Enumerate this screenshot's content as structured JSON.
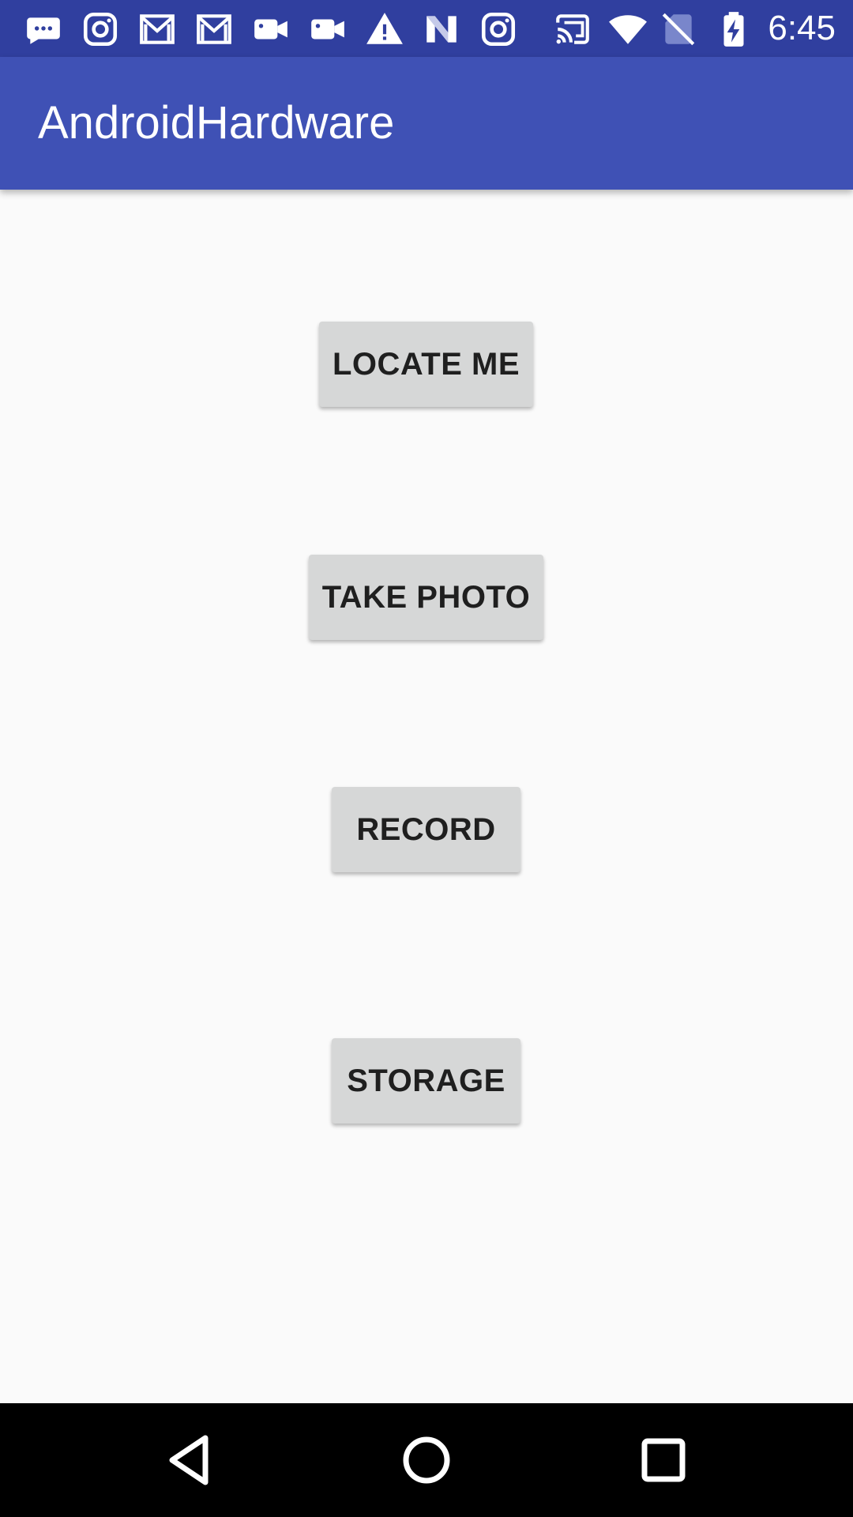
{
  "status_bar": {
    "time": "6:45",
    "background": "#303f9f",
    "notification_icons": [
      "messaging-icon",
      "instagram-icon",
      "gmail-icon",
      "gmail-icon",
      "video-camera-icon",
      "video-camera-icon",
      "warning-icon",
      "n-icon",
      "instagram-icon"
    ],
    "system_icons": [
      "cast-icon",
      "wifi-icon",
      "no-sim-icon",
      "battery-charging-icon"
    ]
  },
  "app_bar": {
    "title": "AndroidHardware",
    "background": "#3f51b5"
  },
  "buttons": {
    "locate_me": "LOCATE ME",
    "take_photo": "TAKE PHOTO",
    "record": "RECORD",
    "storage": "STORAGE"
  },
  "nav_bar": {
    "items": [
      "back-icon",
      "home-icon",
      "recents-icon"
    ]
  }
}
